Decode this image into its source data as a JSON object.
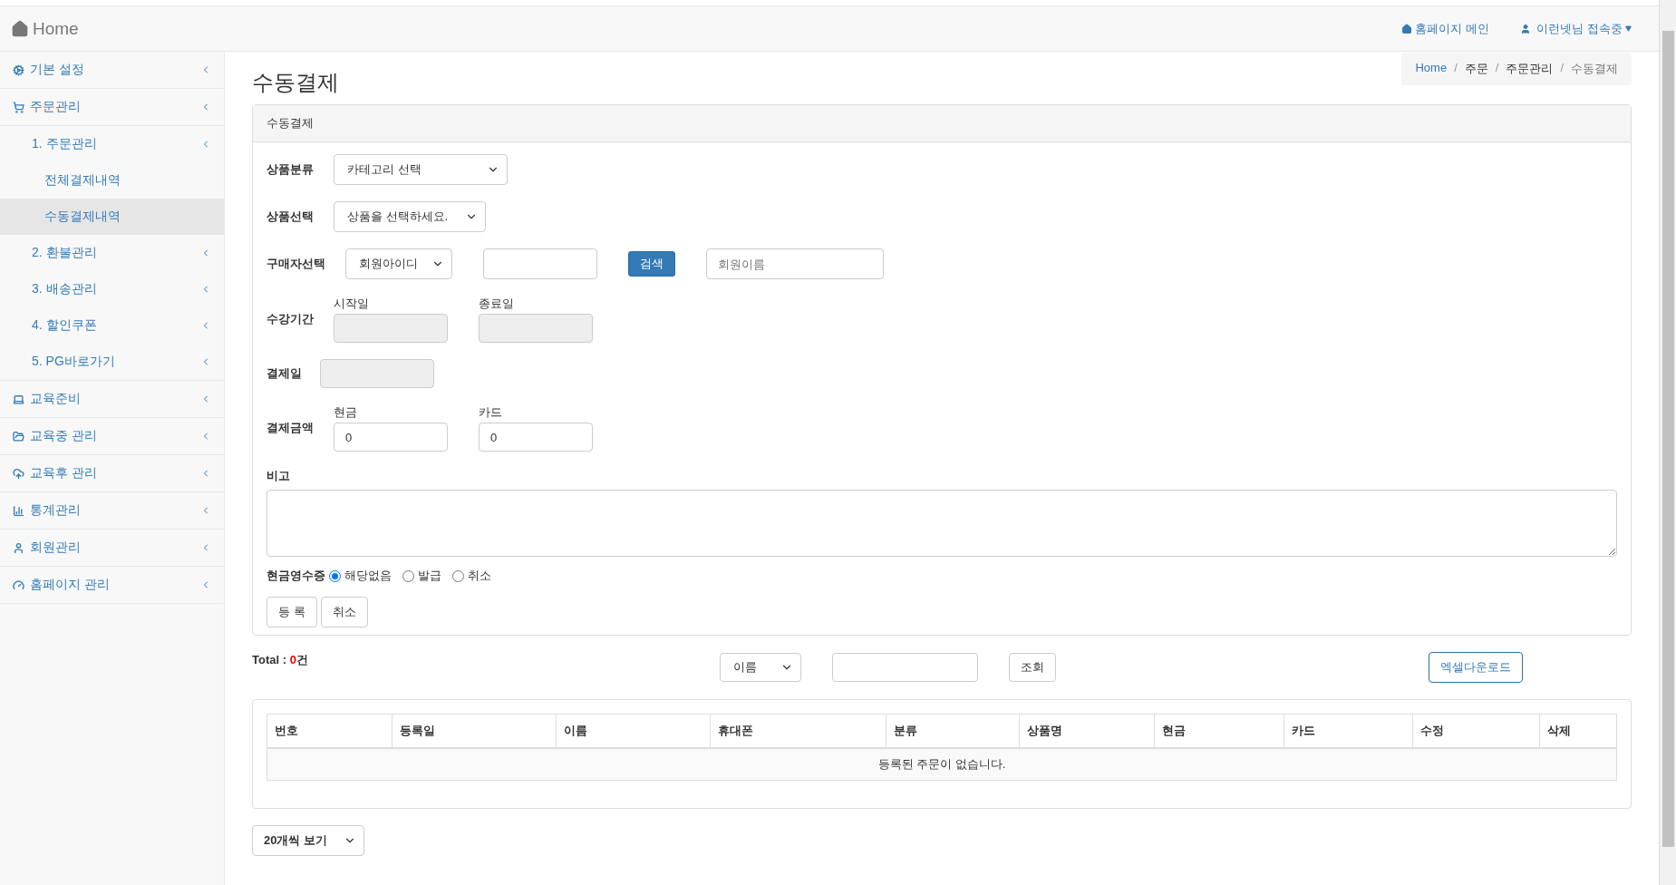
{
  "header": {
    "brand": "Home",
    "home_link": "홈페이지 메인",
    "user_menu": "이런넷님 접속중"
  },
  "sidebar": {
    "items": [
      {
        "label": "기본 설정",
        "kind": "menu",
        "selected": false
      },
      {
        "label": "주문관리",
        "kind": "menu",
        "selected": false,
        "children": [
          {
            "label": "1. 주문관리",
            "kind": "menu",
            "selected": false,
            "children": [
              {
                "label": "전체결제내역",
                "kind": "link",
                "selected": false
              },
              {
                "label": "수동결제내역",
                "kind": "link",
                "selected": true
              }
            ]
          },
          {
            "label": "2. 환불관리",
            "kind": "menu",
            "selected": false
          },
          {
            "label": "3. 배송관리",
            "kind": "menu",
            "selected": false
          },
          {
            "label": "4. 할인쿠폰",
            "kind": "menu",
            "selected": false
          },
          {
            "label": "5. PG바로가기",
            "kind": "menu",
            "selected": false
          }
        ]
      },
      {
        "label": "교육준비",
        "kind": "menu",
        "selected": false
      },
      {
        "label": "교육중 관리",
        "kind": "menu",
        "selected": false
      },
      {
        "label": "교육후 관리",
        "kind": "menu",
        "selected": false
      },
      {
        "label": "통계관리",
        "kind": "menu",
        "selected": false
      },
      {
        "label": "회원관리",
        "kind": "menu",
        "selected": false
      },
      {
        "label": "홈페이지 관리",
        "kind": "menu",
        "selected": false
      }
    ]
  },
  "page": {
    "title": "수동결제",
    "breadcrumb_separator": "/",
    "breadcrumb": [
      {
        "label": "Home",
        "kind": "link"
      },
      {
        "label": "주문",
        "kind": "text"
      },
      {
        "label": "주문관리",
        "kind": "text"
      },
      {
        "label": "수동결제",
        "kind": "current"
      }
    ]
  },
  "form": {
    "title": "수동결제",
    "rows": [
      {
        "kind": "select",
        "label": "상품분류",
        "value": "카테고리 선택"
      },
      {
        "kind": "select",
        "label": "상품선택",
        "value": "상품을 선택하세요."
      },
      {
        "kind": "buyer",
        "label": "구매자선택",
        "select": "회원아이디",
        "button": "검색",
        "placeholder": "회원이름"
      },
      {
        "kind": "pair",
        "label": "수강기간",
        "fields": [
          {
            "caption": "시작일",
            "disabled": true
          },
          {
            "caption": "종료일",
            "disabled": true
          }
        ]
      },
      {
        "kind": "single",
        "label": "결제일",
        "disabled": true
      },
      {
        "kind": "pair",
        "label": "결제금액",
        "fields": [
          {
            "caption": "현금",
            "value": "0",
            "disabled": false
          },
          {
            "caption": "카드",
            "value": "0",
            "disabled": false
          }
        ]
      },
      {
        "kind": "textarea",
        "label": "비고"
      },
      {
        "kind": "radio",
        "label": "현금영수증",
        "options": [
          {
            "label": "해당없음",
            "selected": true
          },
          {
            "label": "발급",
            "selected": false
          },
          {
            "label": "취소",
            "selected": false
          }
        ]
      }
    ],
    "buttons": [
      "등 록",
      "취소"
    ]
  },
  "list": {
    "total": {
      "prefix": "Total : ",
      "count": "0",
      "suffix": "건"
    },
    "filter_select": "이름",
    "search_button": "조회",
    "excel_button": "엑셀다운로드",
    "table": {
      "columns": [
        "번호",
        "등록일",
        "이름",
        "휴대폰",
        "분류",
        "상품명",
        "현금",
        "카드",
        "수정",
        "삭제"
      ],
      "empty_message": "등록된 주문이 없습니다."
    },
    "page_size": "20개씩 보기"
  }
}
